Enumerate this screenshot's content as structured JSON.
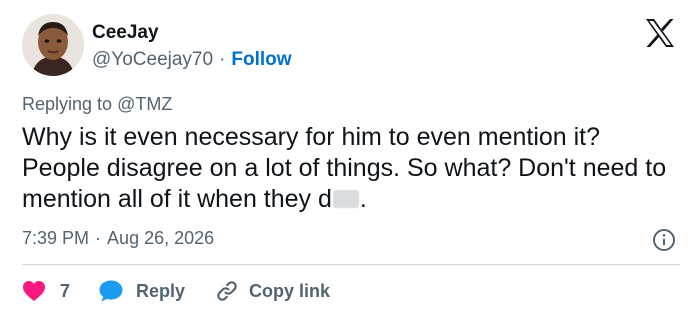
{
  "author": {
    "name": "CeeJay",
    "handle": "@YoCeejay70",
    "separator": "·",
    "follow_label": "Follow"
  },
  "reply_context": {
    "prefix": "Replying to",
    "mention": "@TMZ"
  },
  "tweet": {
    "text_main": "Why is it even necessary for him to even mention it?  People disagree on a lot of things.  So what?  Don't need to mention all of it when they d",
    "text_end": "."
  },
  "meta": {
    "time": "7:39 PM",
    "separator": "·",
    "date": "Aug 26, 2026"
  },
  "actions": {
    "like_count": "7",
    "reply_label": "Reply",
    "copy_label": "Copy link"
  },
  "colors": {
    "like": "#f91880",
    "reply": "#1d9bf0",
    "follow": "#006fd6",
    "muted": "#536471"
  },
  "icons": [
    "x-logo-icon",
    "info-icon",
    "heart-icon",
    "reply-bubble-icon",
    "link-icon"
  ]
}
